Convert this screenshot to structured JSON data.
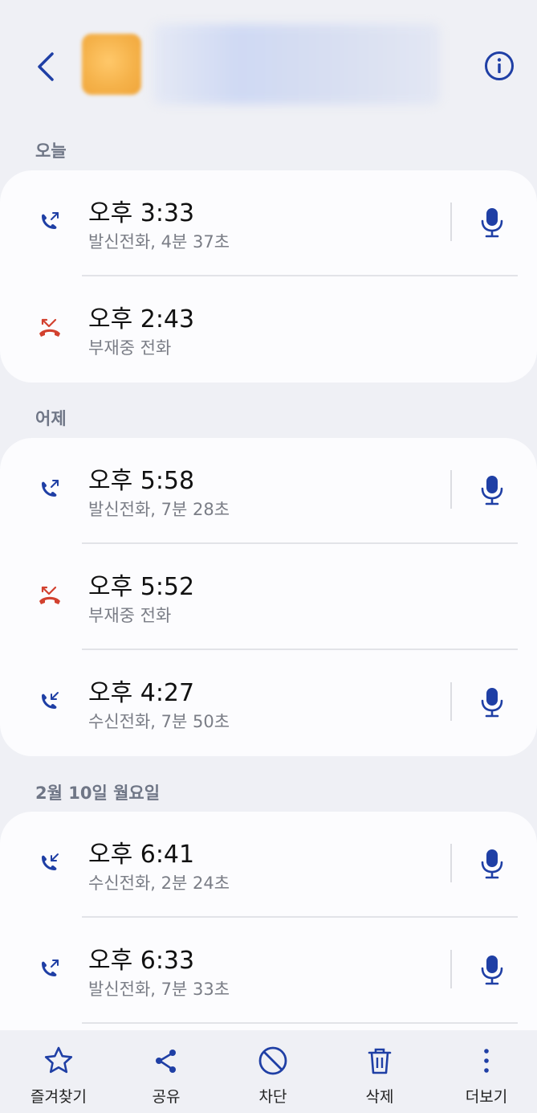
{
  "header": {
    "back_icon": "chevron-left-icon",
    "info_icon": "info-icon"
  },
  "sections": [
    {
      "label": "오늘",
      "calls": [
        {
          "type": "outgoing",
          "time": "오후 3:33",
          "detail": "발신전화, 4분 37초",
          "recording": true
        },
        {
          "type": "missed",
          "time": "오후 2:43",
          "detail": "부재중 전화",
          "recording": false
        }
      ]
    },
    {
      "label": "어제",
      "calls": [
        {
          "type": "outgoing",
          "time": "오후 5:58",
          "detail": "발신전화, 7분 28초",
          "recording": true
        },
        {
          "type": "missed",
          "time": "오후 5:52",
          "detail": "부재중 전화",
          "recording": false
        },
        {
          "type": "incoming",
          "time": "오후 4:27",
          "detail": "수신전화, 7분 50초",
          "recording": true
        }
      ]
    },
    {
      "label": "2월 10일 월요일",
      "calls": [
        {
          "type": "incoming",
          "time": "오후 6:41",
          "detail": "수신전화, 2분 24초",
          "recording": true
        },
        {
          "type": "outgoing",
          "time": "오후 6:33",
          "detail": "발신전화, 7분 33초",
          "recording": true
        }
      ]
    }
  ],
  "bottom_bar": {
    "favorite": "즐겨찾기",
    "share": "공유",
    "block": "차단",
    "delete": "삭제",
    "more": "더보기"
  },
  "colors": {
    "accent": "#1f3fa5",
    "missed": "#d2412f",
    "background": "#eff0f5",
    "card": "#fcfcfe"
  }
}
